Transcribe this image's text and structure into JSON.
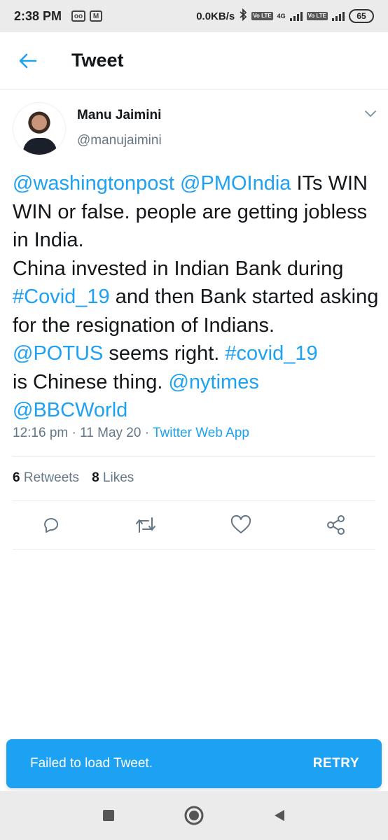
{
  "status_bar": {
    "time": "2:38 PM",
    "network_speed": "0.0KB/s",
    "battery": "65",
    "volte_label": "Vo LTE",
    "network_type": "4G"
  },
  "header": {
    "title": "Tweet"
  },
  "author": {
    "name": "Manu Jaimini",
    "handle": "@manujaimini"
  },
  "tweet": {
    "segments": [
      {
        "text": "@washingtonpost",
        "link": true
      },
      {
        "text": " ",
        "link": false
      },
      {
        "text": "@PMOIndia",
        "link": true
      },
      {
        "text": " ITs WIN WIN or false. people are getting jobless in India.\nChina invested in Indian Bank during ",
        "link": false
      },
      {
        "text": "#Covid_19",
        "link": true
      },
      {
        "text": " and then Bank started asking for the resignation of Indians.\n",
        "link": false
      },
      {
        "text": "@POTUS",
        "link": true
      },
      {
        "text": " seems right. ",
        "link": false
      },
      {
        "text": "#covid_19",
        "link": true
      },
      {
        "text": "\nis Chinese thing. ",
        "link": false
      },
      {
        "text": "@nytimes",
        "link": true
      },
      {
        "text": "\n",
        "link": false
      },
      {
        "text": "@BBCWorld",
        "link": true
      }
    ],
    "time": "12:16 pm",
    "separator": " · ",
    "date": "11 May 20",
    "source": "Twitter Web App"
  },
  "stats": {
    "retweets_count": "6",
    "retweets_label": "Retweets",
    "likes_count": "8",
    "likes_label": "Likes"
  },
  "actions": {
    "reply": "reply-icon",
    "retweet": "retweet-icon",
    "like": "heart-icon",
    "share": "share-icon"
  },
  "snackbar": {
    "message": "Failed to load Tweet.",
    "action": "RETRY"
  },
  "colors": {
    "accent": "#1da1f2",
    "text_primary": "#14171a",
    "text_secondary": "#657786",
    "divider": "#e6ecf0"
  }
}
